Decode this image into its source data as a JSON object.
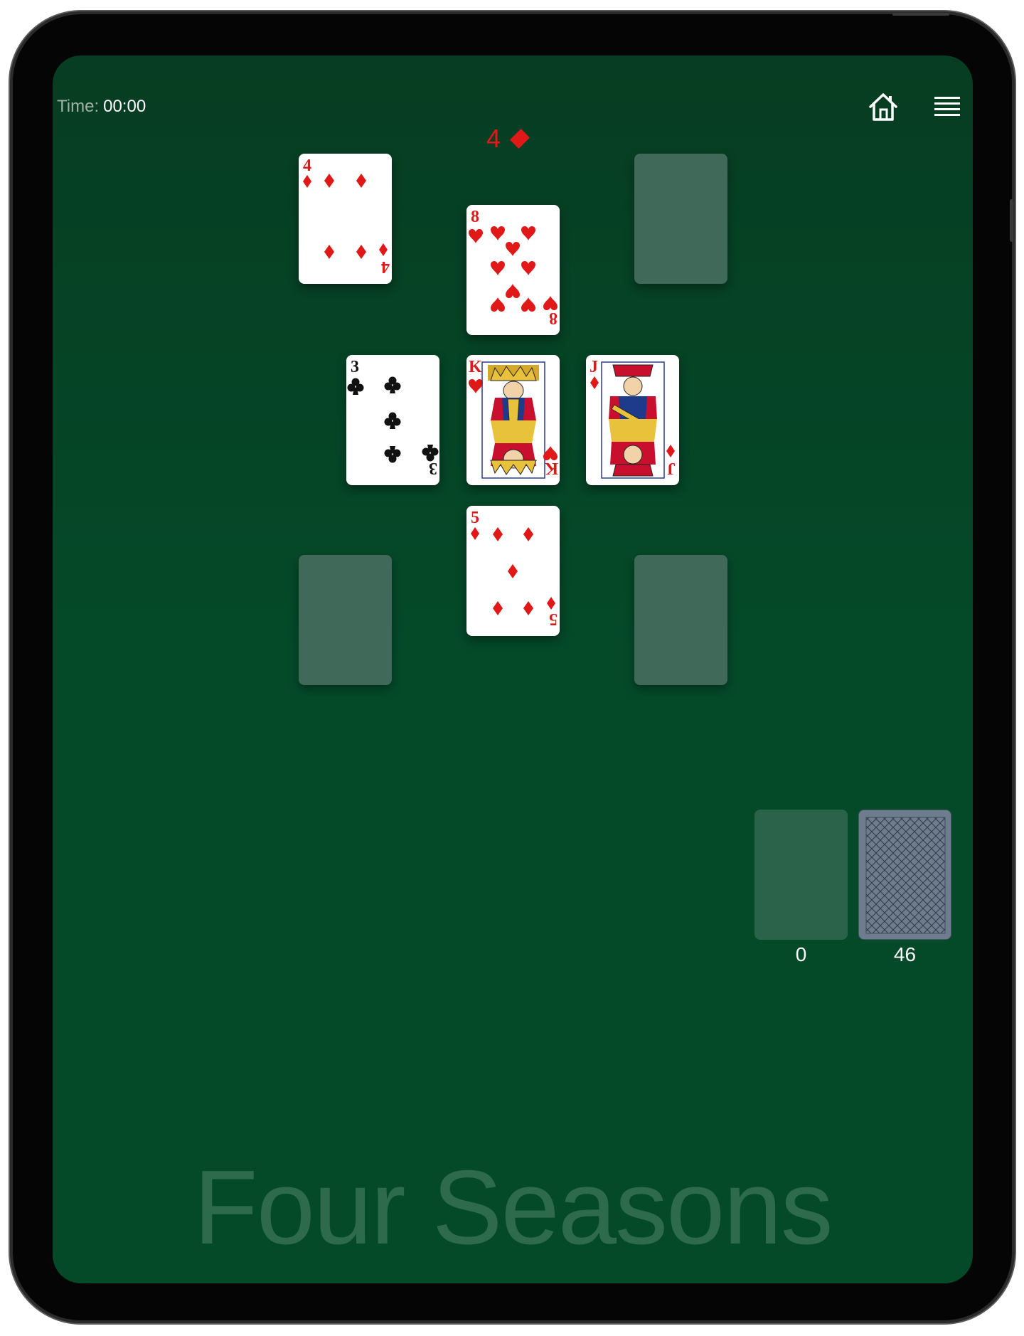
{
  "status": {
    "time_label": "Time:",
    "time_value": "00:00"
  },
  "toolbar": {
    "home_icon": "house-icon",
    "menu_icon": "hamburger-menu-icon"
  },
  "foundation": {
    "rank": "4",
    "suit": "diamonds",
    "suit_color": "#e01818"
  },
  "tableau": {
    "top_left": {
      "rank": "4",
      "suit": "diamonds"
    },
    "top_center": {
      "rank": "8",
      "suit": "hearts"
    },
    "top_right": {
      "empty": true
    },
    "middle_left": {
      "rank": "3",
      "suit": "clubs"
    },
    "center": {
      "rank": "K",
      "suit": "hearts"
    },
    "middle_right": {
      "rank": "J",
      "suit": "diamonds"
    },
    "bottom_center": {
      "rank": "5",
      "suit": "diamonds"
    },
    "bottom_left": {
      "empty": true
    },
    "bottom_right": {
      "empty": true
    }
  },
  "waste": {
    "count": "0"
  },
  "stock": {
    "count": "46"
  },
  "game_title": "Four Seasons",
  "colors": {
    "felt": "#044a29",
    "red_suit": "#e01818",
    "card_back": "#6e7d8e"
  }
}
